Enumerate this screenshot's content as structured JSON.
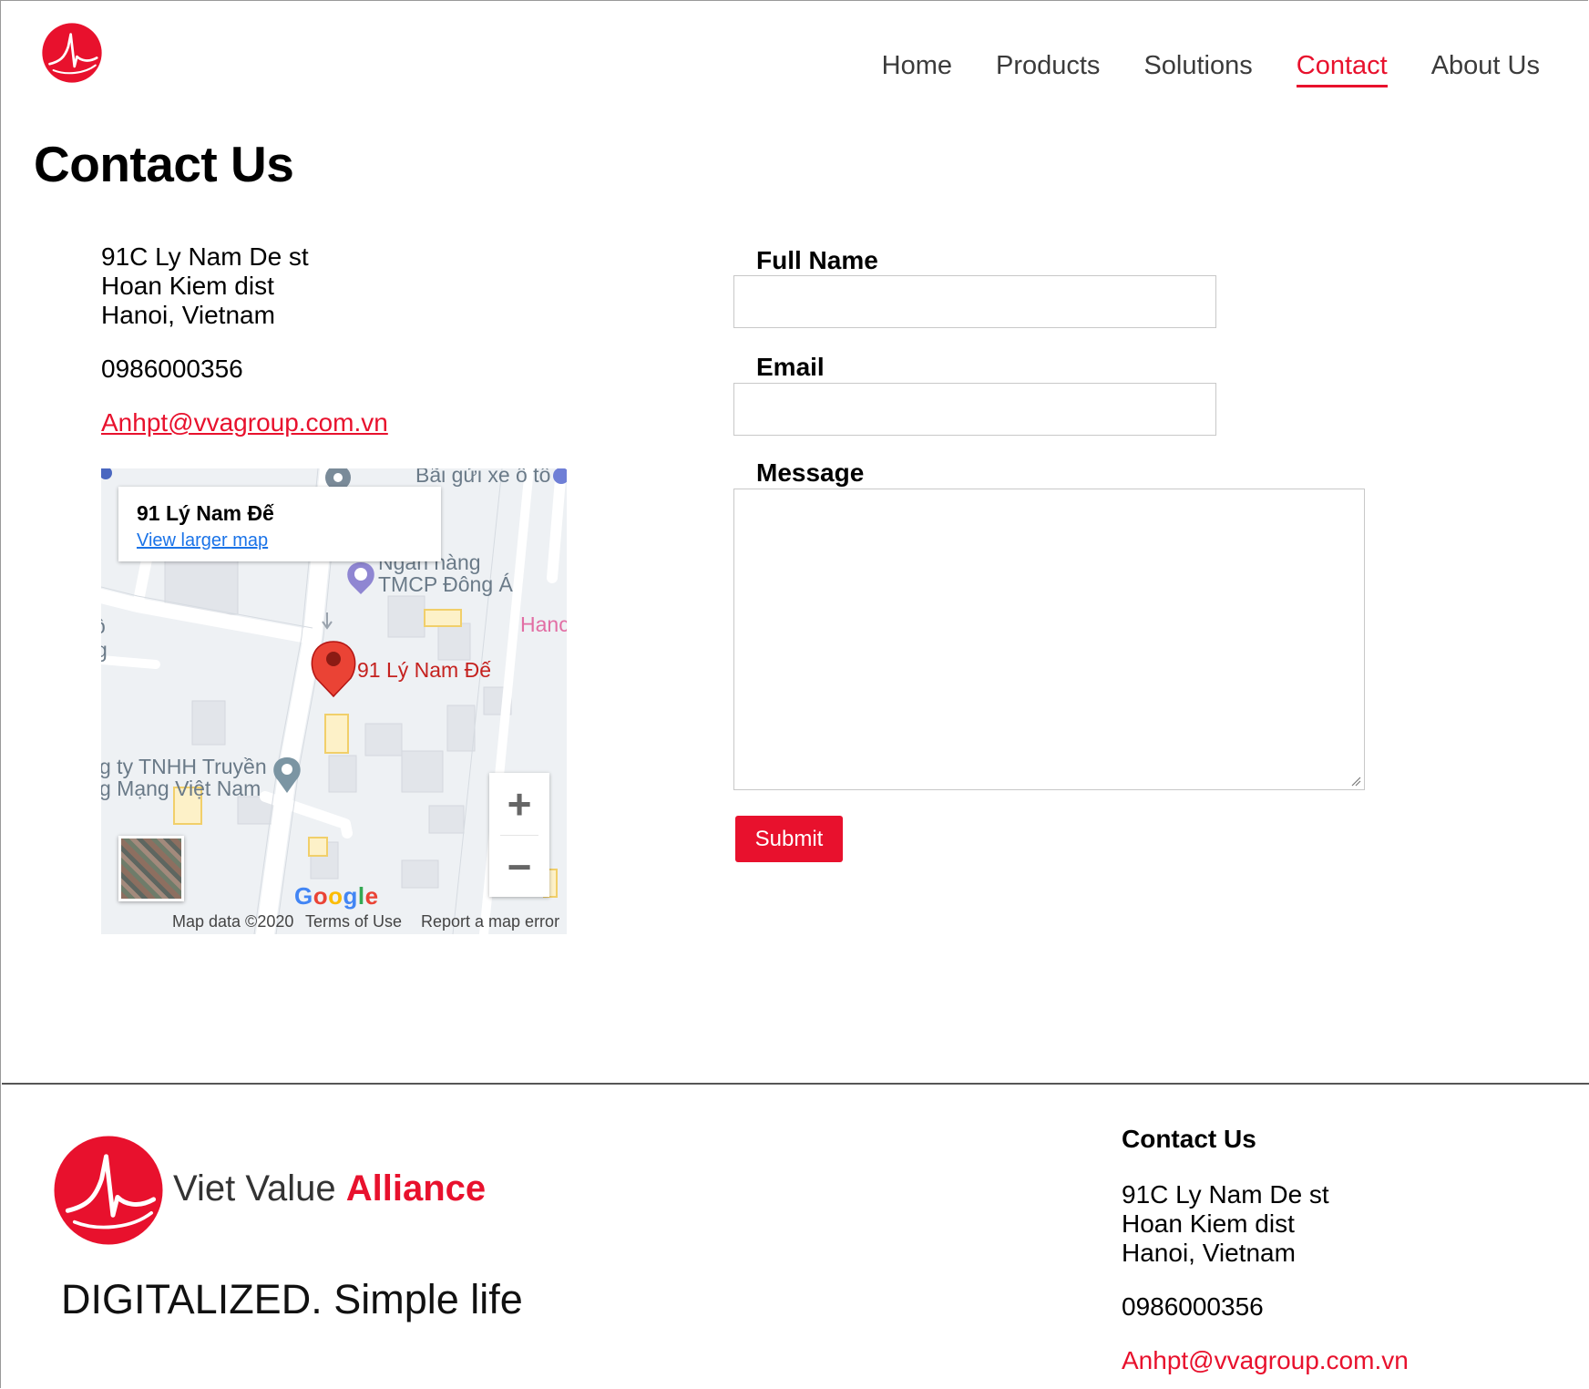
{
  "header": {
    "nav": [
      {
        "label": "Home",
        "active": false
      },
      {
        "label": "Products",
        "active": false
      },
      {
        "label": "Solutions",
        "active": false
      },
      {
        "label": "Contact",
        "active": true
      },
      {
        "label": "About Us",
        "active": false
      }
    ]
  },
  "page": {
    "title": "Contact Us"
  },
  "contact_info": {
    "address": [
      "91C Ly Nam De st",
      "Hoan Kiem dist",
      "Hanoi, Vietnam"
    ],
    "phone": "0986000356",
    "email": "Anhpt@vvagroup.com.vn"
  },
  "map": {
    "place_name": "91 Lý Nam Đế",
    "view_larger": "View larger map",
    "labels": {
      "top_label": "Bãi gửi xe ô tô",
      "bank_line1": "Ngân hàng",
      "bank_line2": "TMCP Đông Á",
      "pin_label": "91 Lý Nam Đế",
      "left_partial1": "ộ",
      "left_partial2": "g",
      "right_partial": "Hanc",
      "company_line1": "g ty TNHH Truyền",
      "company_line2": "g Mạng Việt Nam"
    },
    "zoom_in": "+",
    "zoom_out": "−",
    "google": "Google",
    "attribution": {
      "map_data": "Map data ©2020",
      "terms": "Terms of Use",
      "report": "Report a map error"
    }
  },
  "form": {
    "full_name_label": "Full Name",
    "email_label": "Email",
    "message_label": "Message",
    "full_name_value": "",
    "email_value": "",
    "message_value": "",
    "submit_label": "Submit"
  },
  "footer": {
    "brand_part1": "Viet Value ",
    "brand_part2": "Alliance",
    "tagline": "DIGITALIZED. Simple life",
    "contact_title": "Contact Us",
    "address": [
      "91C Ly Nam De st",
      "Hoan Kiem dist",
      "Hanoi, Vietnam"
    ],
    "phone": "0986000356",
    "email": "Anhpt@vvagroup.com.vn"
  },
  "colors": {
    "accent": "#e8112d",
    "nav_text": "#3b3b3b",
    "link_blue": "#1a73e8"
  }
}
